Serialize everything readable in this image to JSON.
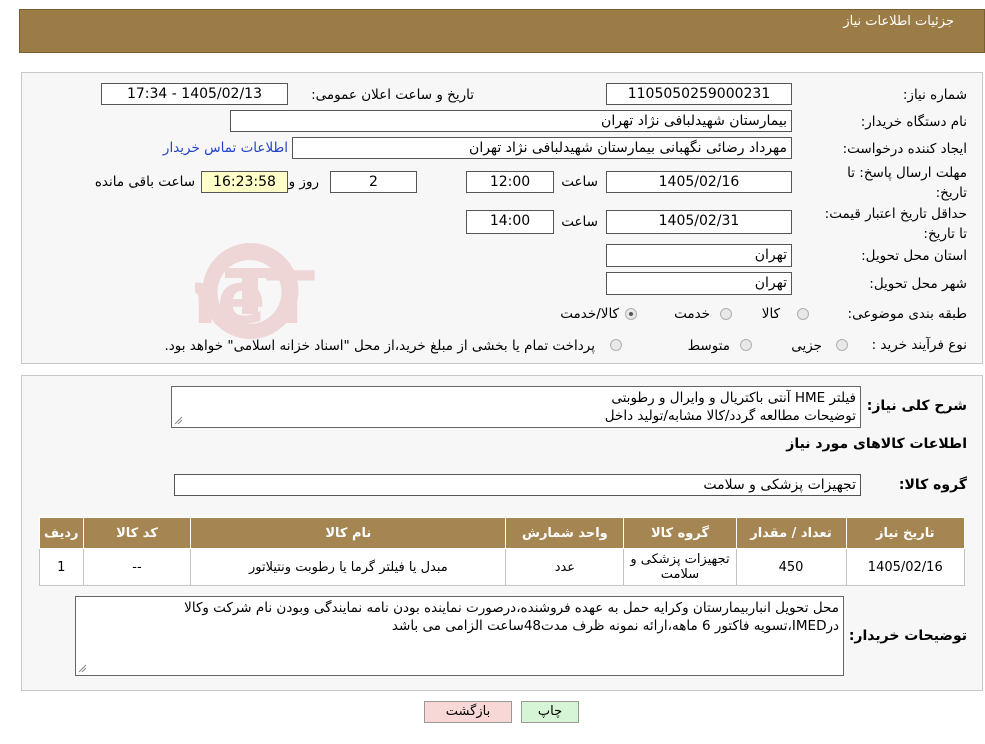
{
  "header": {
    "title": "جزئیات اطلاعات نیاز"
  },
  "info": {
    "need_number_label": "شماره نیاز:",
    "need_number": "1105050259000231",
    "announce_label": "تاریخ و ساعت اعلان عمومی:",
    "announce_value": "1405/02/13 - 17:34",
    "buyer_org_label": "نام دستگاه خریدار:",
    "buyer_org": "بیمارستان شهیدلبافی نژاد تهران",
    "requester_label": "ایجاد کننده درخواست:",
    "requester": "مهرداد رضائی نگهبانی بیمارستان شهیدلبافی نژاد تهران",
    "contact_link": "اطلاعات تماس خریدار",
    "deadline_label": "مهلت ارسال پاسخ: تا تاریخ:",
    "deadline_date": "1405/02/16",
    "time_label": "ساعت",
    "deadline_time": "12:00",
    "days_value": "2",
    "days_label": "روز و",
    "remaining_time": "16:23:58",
    "remaining_label": "ساعت باقی مانده",
    "validity_label": "حداقل تاریخ اعتبار قیمت: تا تاریخ:",
    "validity_date": "1405/02/31",
    "validity_time": "14:00",
    "province_label": "استان محل تحویل:",
    "province": "تهران",
    "city_label": "شهر محل تحویل:",
    "city": "تهران",
    "category_label": "طبقه بندی موضوعی:",
    "category_options": [
      "کالا",
      "خدمت",
      "کالا/خدمت"
    ],
    "process_label": "نوع فرآیند خرید :",
    "process_options": [
      "جزیی",
      "متوسط"
    ],
    "process_note": "پرداخت تمام یا بخشی از مبلغ خرید،از محل \"اسناد خزانه اسلامی\" خواهد بود."
  },
  "description": {
    "label": "شرح کلی نیاز:",
    "line1": "فیلتر HME آنتی باکتریال و وایرال و رطوبتی",
    "line2": "توضیحات مطالعه گردد/کالا مشابه/تولید داخل"
  },
  "goods": {
    "section_title": "اطلاعات کالاهای مورد نیاز",
    "group_label": "گروه کالا:",
    "group_value": "تجهیزات پزشکی و سلامت",
    "headers": [
      "ردیف",
      "کد کالا",
      "نام کالا",
      "واحد شمارش",
      "گروه کالا",
      "تعداد / مقدار",
      "تاریخ نیاز"
    ],
    "rows": [
      [
        "1",
        "--",
        "مبدل یا فیلتر گرما یا رطوبت ونتیلاتور",
        "عدد",
        "تجهیزات پزشکی و سلامت",
        "450",
        "1405/02/16"
      ]
    ]
  },
  "buyer_notes": {
    "label": "توضیحات خریدار:",
    "line1": "محل تحویل انباربیمارستان وکرایه حمل به عهده فروشنده،درصورت نماینده بودن نامه نمایندگی وبودن نام شرکت وکالا",
    "line2": "درIMED،تسویه فاکتور 6 ماهه،ارائه نمونه ظرف مدت48ساعت الزامی می باشد"
  },
  "buttons": {
    "print": "چاپ",
    "back": "بازگشت"
  },
  "colors": {
    "header_bg": "#9c7c46",
    "table_header_bg": "#a58652",
    "link": "#2244cc",
    "back_btn_bg": "#f8d7d7",
    "print_btn_bg": "#d6f5d6"
  }
}
